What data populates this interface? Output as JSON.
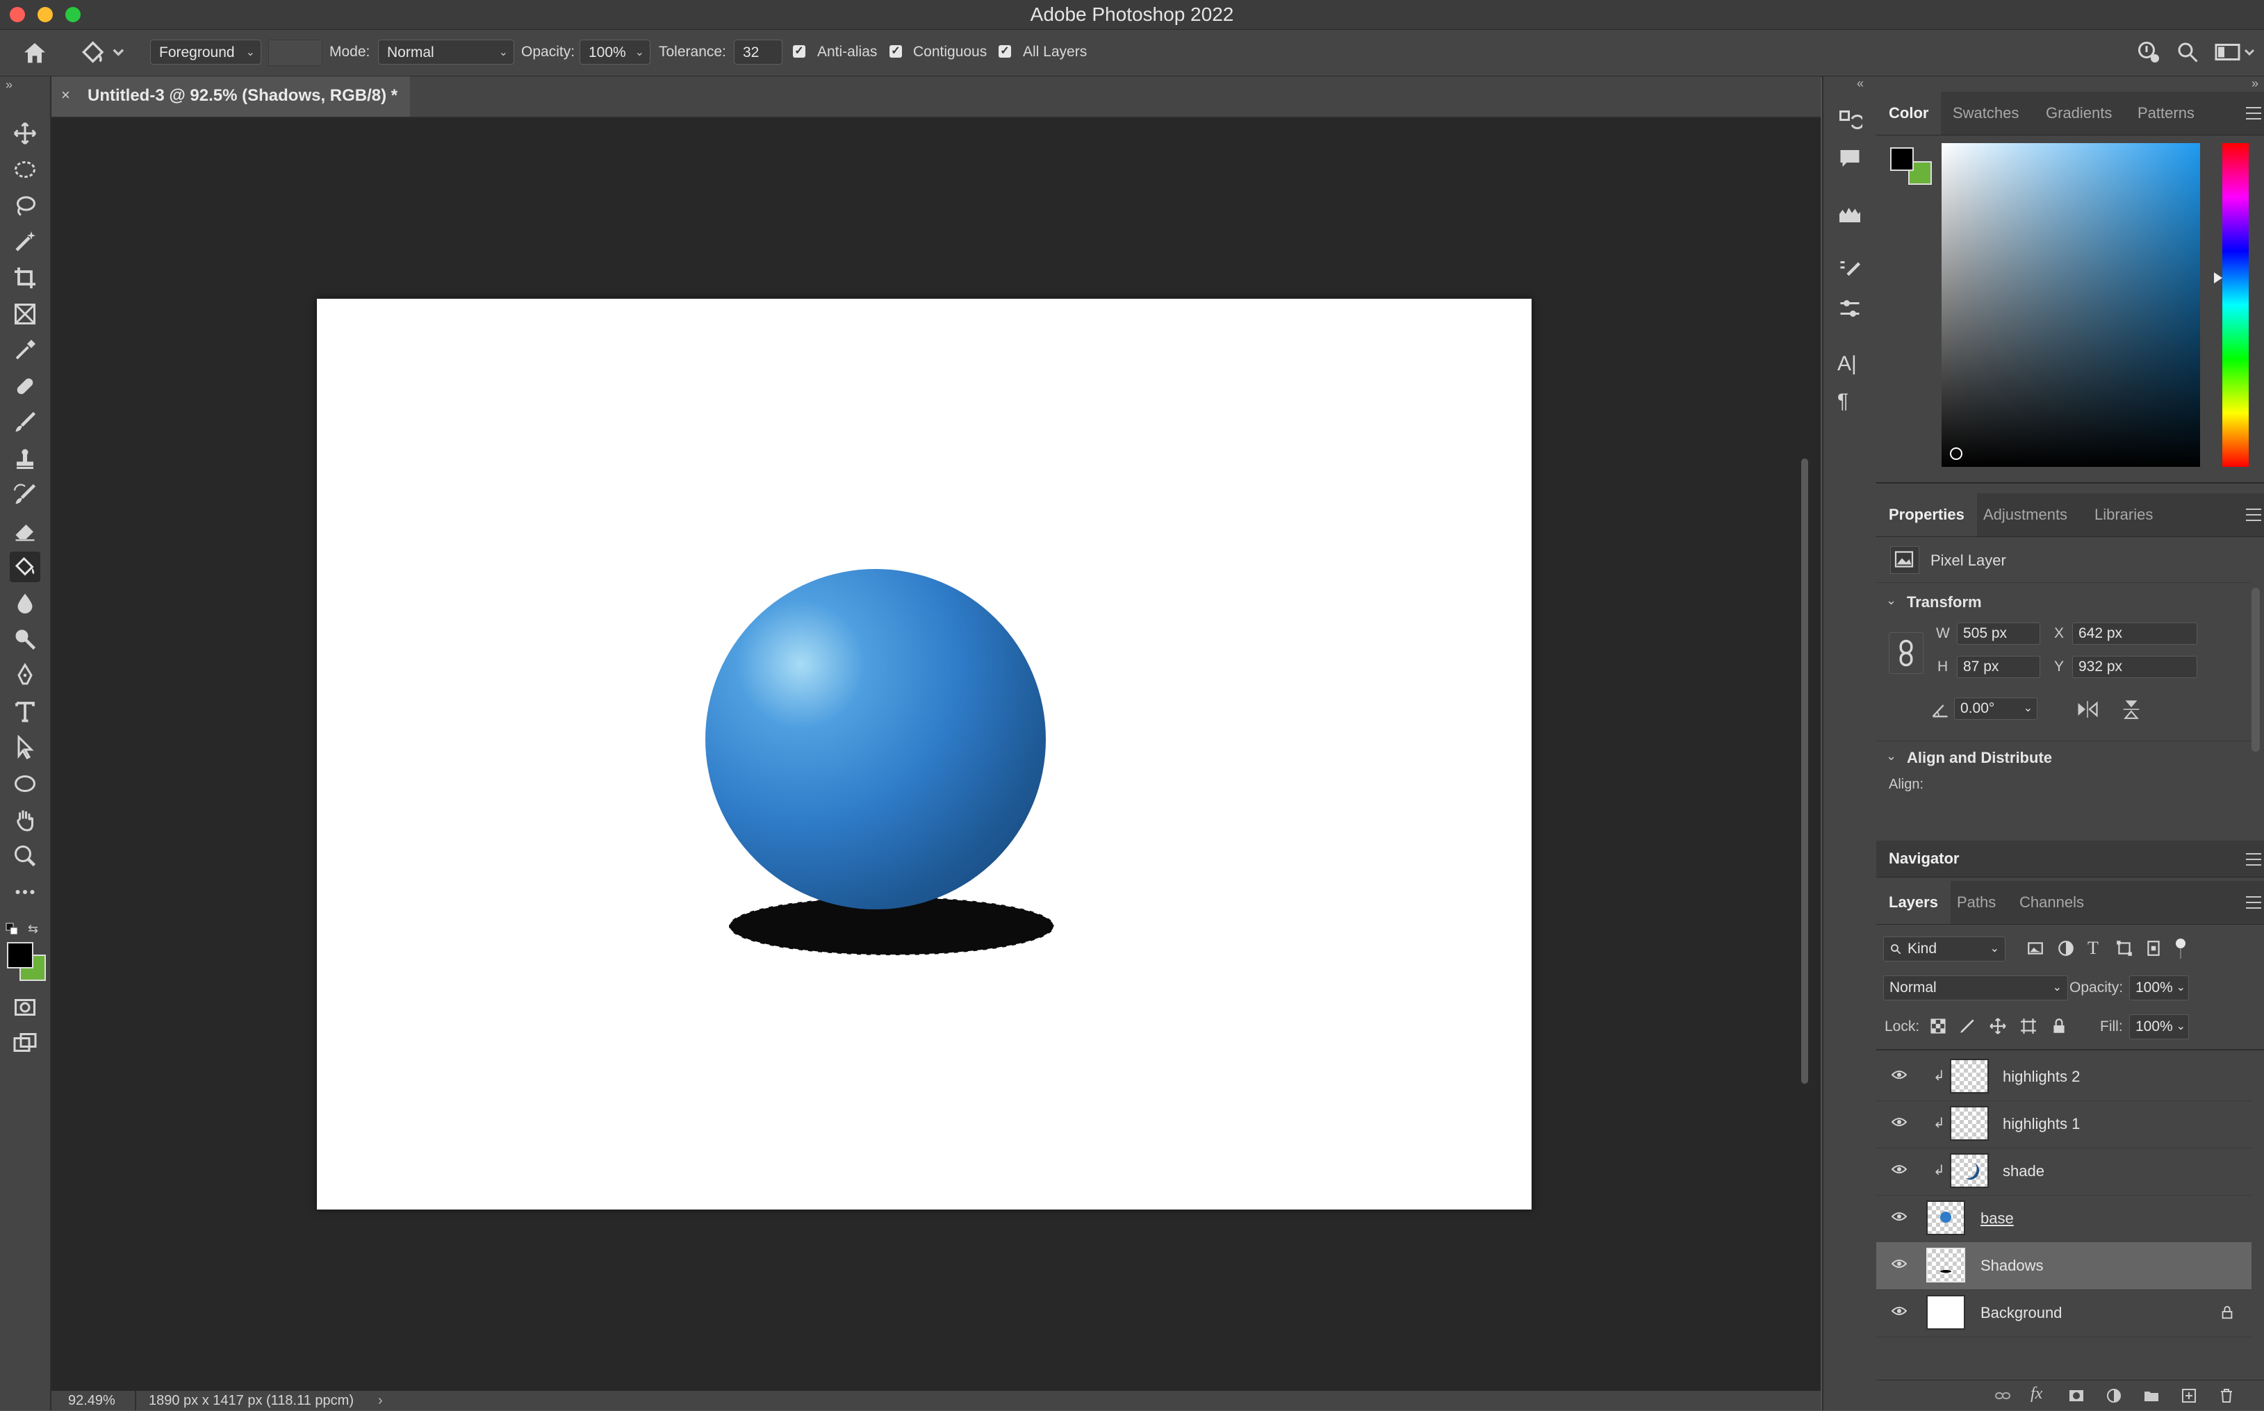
{
  "app": {
    "title": "Adobe Photoshop 2022"
  },
  "options_bar": {
    "fill_source": "Foreground",
    "mode_label": "Mode:",
    "mode_value": "Normal",
    "opacity_label": "Opacity:",
    "opacity_value": "100%",
    "tolerance_label": "Tolerance:",
    "tolerance_value": "32",
    "anti_alias_label": "Anti-alias",
    "anti_alias_checked": true,
    "contiguous_label": "Contiguous",
    "contiguous_checked": true,
    "all_layers_label": "All Layers"
  },
  "document": {
    "tab_title": "Untitled-3 @ 92.5% (Shadows, RGB/8) *",
    "zoom": "92.49%",
    "dimensions": "1890 px x 1417 px (118.11 ppcm)"
  },
  "colors": {
    "foreground": "#000000",
    "background": "#6bb23a",
    "sphere": "#2f7bc8"
  },
  "color_panel": {
    "tabs": [
      "Color",
      "Swatches",
      "Gradients",
      "Patterns"
    ],
    "active_tab": "Color"
  },
  "properties_panel": {
    "tabs": [
      "Properties",
      "Adjustments",
      "Libraries"
    ],
    "layer_type": "Pixel Layer",
    "transform_label": "Transform",
    "w_label": "W",
    "w_value": "505 px",
    "h_label": "H",
    "h_value": "87 px",
    "x_label": "X",
    "x_value": "642 px",
    "y_label": "Y",
    "y_value": "932 px",
    "angle_value": "0.00°",
    "align_label": "Align and Distribute",
    "align_sub": "Align:"
  },
  "navigator": {
    "title": "Navigator"
  },
  "layers_panel": {
    "tabs": [
      "Layers",
      "Paths",
      "Channels"
    ],
    "filter_kind": "Kind",
    "blend_mode": "Normal",
    "opacity_label": "Opacity:",
    "opacity_value": "100%",
    "lock_label": "Lock:",
    "fill_label": "Fill:",
    "fill_value": "100%",
    "layers": [
      {
        "name": "highlights 2",
        "clipped": true
      },
      {
        "name": "highlights 1",
        "clipped": true
      },
      {
        "name": "shade",
        "clipped": true
      },
      {
        "name": "base",
        "clipped": false
      },
      {
        "name": "Shadows",
        "clipped": false,
        "selected": true
      },
      {
        "name": "Background",
        "clipped": false,
        "locked": true
      }
    ]
  }
}
